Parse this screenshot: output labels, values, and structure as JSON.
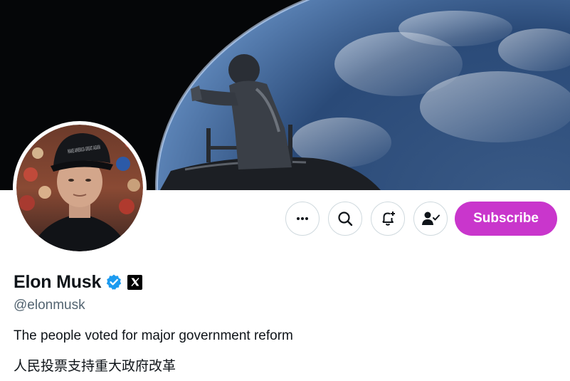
{
  "profile": {
    "display_name": "Elon Musk",
    "handle": "@elonmusk",
    "verified_color": "#1d9bf0",
    "bio": [
      "The people voted for major government reform",
      "人民投票支持重大政府改革"
    ],
    "avatar_hat_text": "MAKE AMERICA GREAT AGAIN"
  },
  "actions": {
    "more_icon": "more-icon",
    "search_icon": "search-icon",
    "notify_icon": "bell-plus-icon",
    "following_icon": "person-check-icon",
    "subscribe_label": "Subscribe",
    "subscribe_color": "#c936cc"
  },
  "banner": {
    "description_icon": "space-earth-image"
  }
}
